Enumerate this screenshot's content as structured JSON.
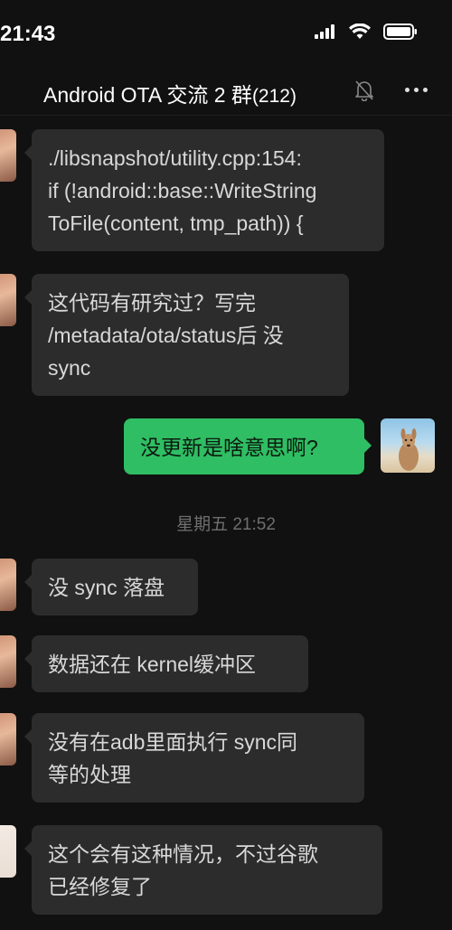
{
  "status_bar": {
    "time": "21:43",
    "icons": [
      "cellular-signal-icon",
      "wifi-icon",
      "battery-icon"
    ]
  },
  "header": {
    "title": "Android OTA 交流 2 群",
    "count": "(212)",
    "mute_icon": "bell-slash-icon",
    "more_icon": "more-dots-icon"
  },
  "messages": [
    {
      "sender": "other",
      "lines": [
        "./libsnapshot/utility.cpp:154:",
        "if (!android::base::WriteString",
        "ToFile(content, tmp_path)) {"
      ]
    },
    {
      "sender": "other",
      "lines": [
        "这代码有研究过？写完",
        "/metadata/ota/status后 没",
        "sync"
      ]
    },
    {
      "sender": "self",
      "lines": [
        "没更新是啥意思啊?"
      ]
    },
    {
      "sender": "other",
      "lines": [
        "没 sync 落盘"
      ]
    },
    {
      "sender": "other",
      "lines": [
        "数据还在 kernel缓冲区"
      ]
    },
    {
      "sender": "other",
      "lines": [
        "没有在adb里面执行 sync同",
        "等的处理"
      ]
    },
    {
      "sender": "other",
      "lines": [
        "这个会有这种情况，不过谷歌",
        "已经修复了"
      ]
    }
  ],
  "timestamp": "星期五 21:52",
  "colors": {
    "background": "#111111",
    "bubble_other": "#2c2c2c",
    "bubble_self": "#2fbe63",
    "text": "#d8d8d8"
  }
}
